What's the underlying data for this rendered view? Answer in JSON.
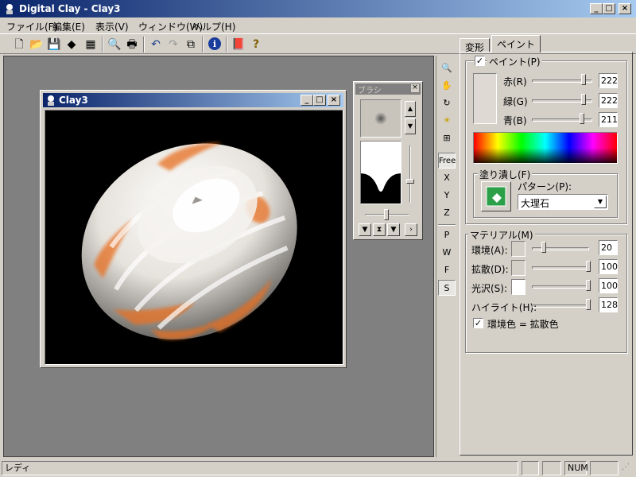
{
  "app": {
    "title": "Digital Clay - Clay3"
  },
  "menu": [
    "ファイル(F)",
    "編集(E)",
    "表示(V)",
    "ウィンドウ(W)",
    "ヘルプ(H)"
  ],
  "toolbar_icons": [
    "new-icon",
    "open-icon",
    "save-icon",
    "export-icon",
    "image-icon",
    "print-preview-icon",
    "print-icon",
    "undo-icon",
    "redo-icon",
    "copy-icon",
    "info-icon",
    "book-icon",
    "help-icon"
  ],
  "clay_window": {
    "title": "Clay3"
  },
  "brush_panel": {
    "title": "ブラシ"
  },
  "vtools": {
    "free": "Free",
    "x": "X",
    "y": "Y",
    "z": "Z",
    "p": "P",
    "w": "W",
    "f": "F",
    "s": "S"
  },
  "tabs": {
    "deform": "変形",
    "paint": "ペイント"
  },
  "paint": {
    "checkbox_label": "ペイント(P)",
    "red_label": "赤(R)",
    "green_label": "緑(G)",
    "blue_label": "青(B)",
    "red": "222",
    "green": "222",
    "blue": "211",
    "swatch_color": "#dedad3",
    "fill_label": "塗り潰し(F)",
    "pattern_label": "パターン(P):",
    "pattern_value": "大理石"
  },
  "material": {
    "label": "マテリアル(M)",
    "ambient_label": "環境(A):",
    "ambient": "20",
    "diffuse_label": "拡散(D):",
    "diffuse": "100",
    "gloss_label": "光沢(S):",
    "gloss": "100",
    "highlight_label": "ハイライト(H):",
    "highlight": "128",
    "link_label": "環境色 = 拡散色"
  },
  "status": {
    "text": "レディ",
    "num": "NUM"
  },
  "colors": {
    "titlebar": "#0a246a",
    "object_orange": "#e87020"
  }
}
